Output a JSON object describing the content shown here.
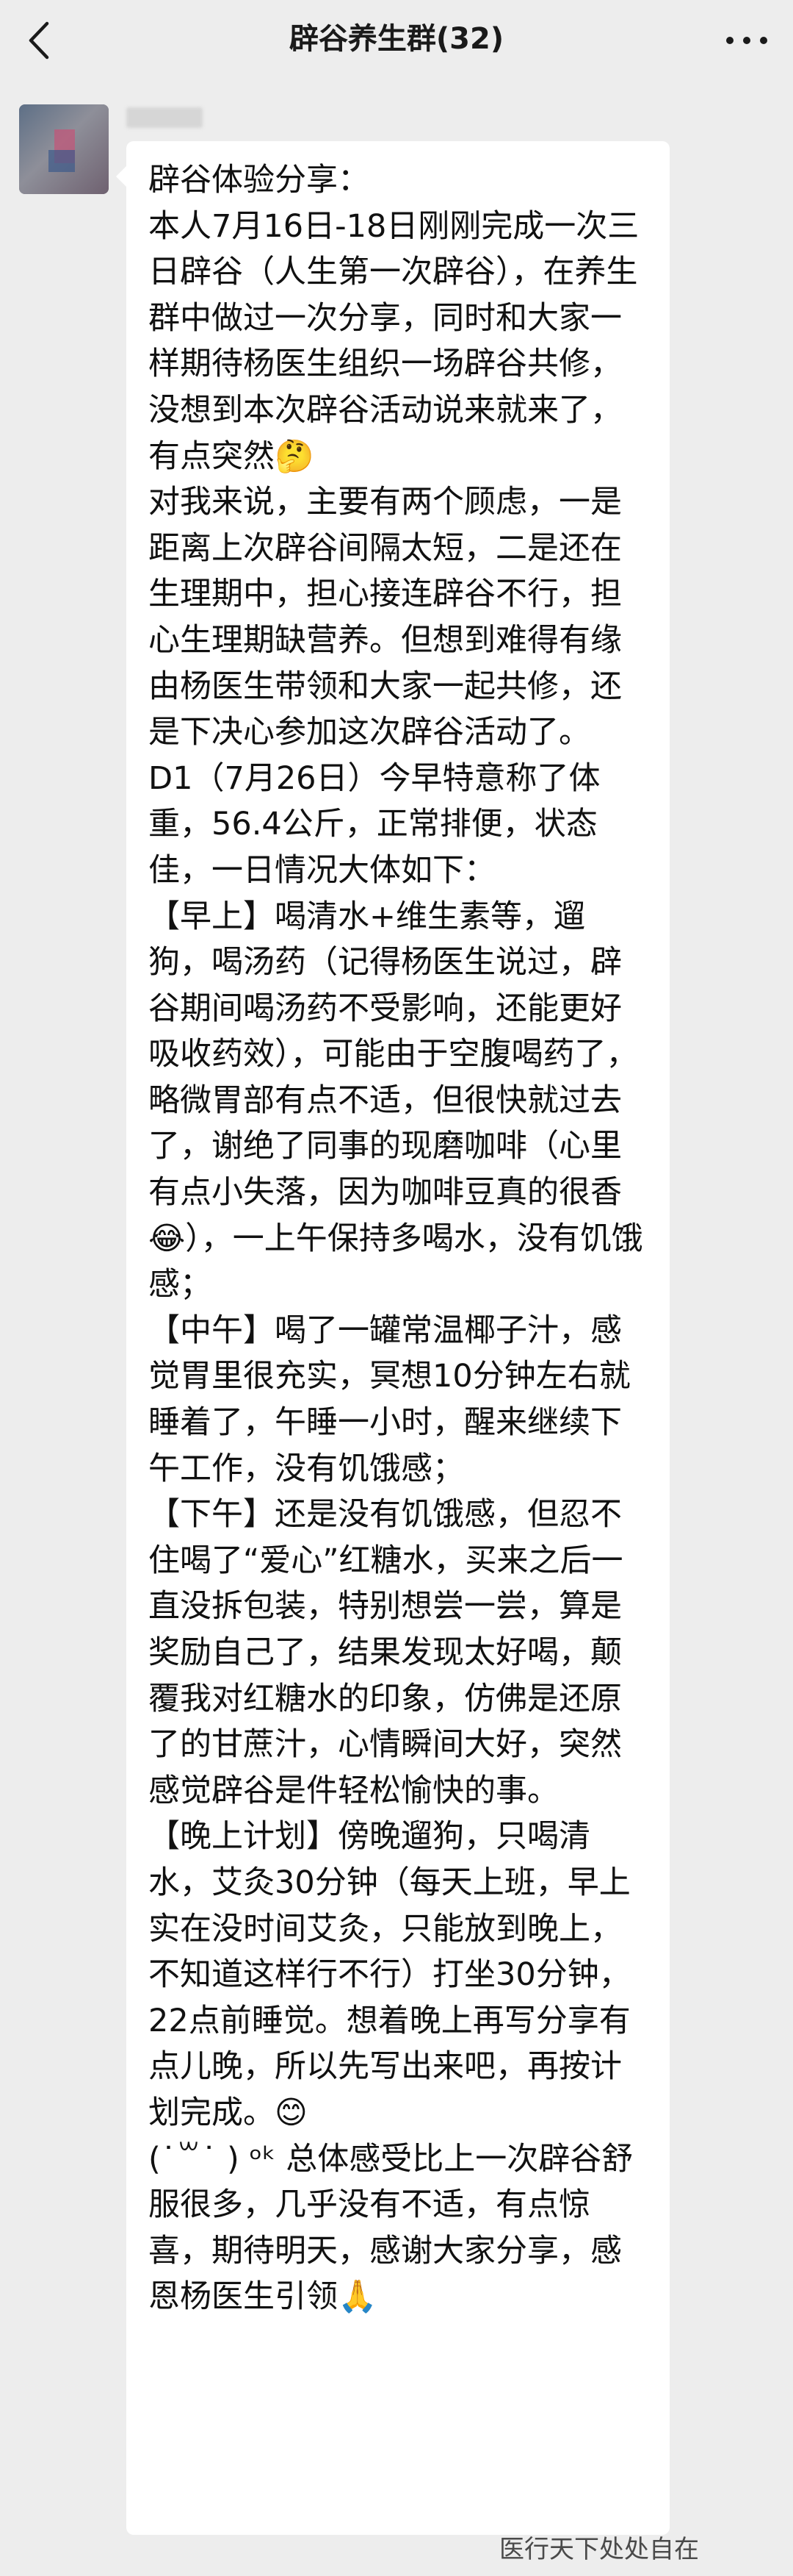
{
  "header": {
    "title": "辟谷养生群(32)"
  },
  "icons": {
    "back": "back-chevron-icon",
    "more": "more-dots-icon",
    "emoji": [
      "thinking-face-emoji",
      "tears-of-joy-emoji",
      "smiling-face-emoji",
      "folded-hands-emoji"
    ]
  },
  "message": {
    "text": "辟谷体验分享：\n本人7月16日-18日刚刚完成一次三日辟谷（人生第一次辟谷），在养生群中做过一次分享，同时和大家一样期待杨医生组织一场辟谷共修，没想到本次辟谷活动说来就来了，有点突然🤔\n对我来说，主要有两个顾虑，一是距离上次辟谷间隔太短，二是还在生理期中，担心接连辟谷不行，担心生理期缺营养。但想到难得有缘由杨医生带领和大家一起共修，还是下决心参加这次辟谷活动了。\nD1（7月26日）今早特意称了体重，56.4公斤，正常排便，状态佳，一日情况大体如下：\n【早上】喝清水+维生素等，遛狗，喝汤药（记得杨医生说过，辟谷期间喝汤药不受影响，还能更好吸收药效），可能由于空腹喝药了，略微胃部有点不适，但很快就过去了，谢绝了同事的现磨咖啡（心里有点小失落，因为咖啡豆真的很香😂），一上午保持多喝水，没有饥饿感；\n【中午】喝了一罐常温椰子汁，感觉胃里很充实，冥想10分钟左右就睡着了，午睡一小时，醒来继续下午工作，没有饥饿感；\n【下午】还是没有饥饿感，但忍不住喝了“爱心”红糖水，买来之后一直没拆包装，特别想尝一尝，算是奖励自己了，结果发现太好喝，颠覆我对红糖水的印象，仿佛是还原了的甘蔗汁，心情瞬间大好，突然感觉辟谷是件轻松愉快的事。\n【晚上计划】傍晚遛狗，只喝清水，艾灸30分钟（每天上班，早上实在没时间艾灸，只能放到晚上，不知道这样行不行）打坐30分钟，22点前睡觉。想着晚上再写分享有点儿晚，所以先写出来吧，再按计划完成。😊\n(˙꒳˙ ) ᵒᵏ 总体感受比上一次辟谷舒服很多，几乎没有不适，有点惊喜，期待明天，感谢大家分享，感恩杨医生引领🙏"
  },
  "watermark": {
    "text": "医行天下处处自在"
  }
}
